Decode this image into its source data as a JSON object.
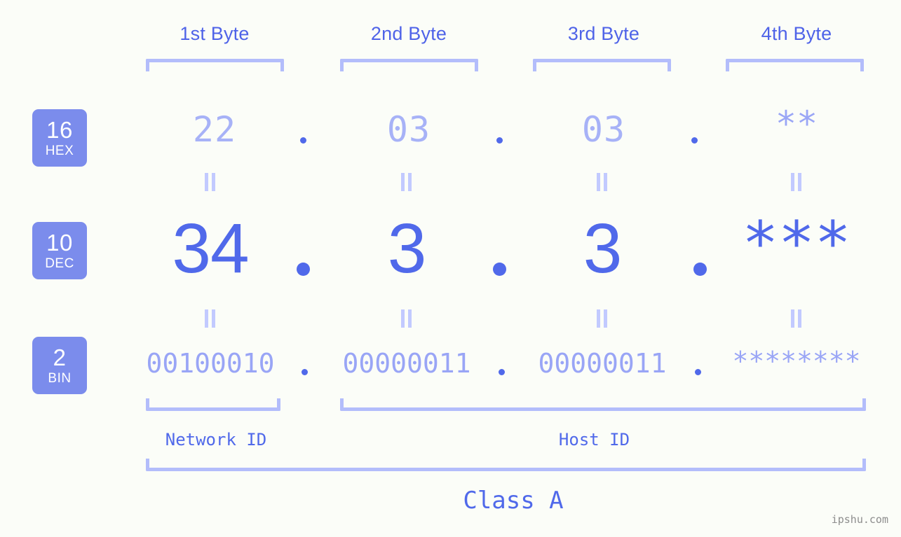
{
  "bytes": [
    {
      "label": "1st Byte"
    },
    {
      "label": "2nd Byte"
    },
    {
      "label": "3rd Byte"
    },
    {
      "label": "4th Byte"
    }
  ],
  "bases": [
    {
      "num": "16",
      "name": "HEX"
    },
    {
      "num": "10",
      "name": "DEC"
    },
    {
      "num": "2",
      "name": "BIN"
    }
  ],
  "rows": {
    "hex": {
      "values": [
        "22",
        "03",
        "03",
        "**"
      ],
      "separator": "."
    },
    "dec": {
      "values": [
        "34",
        "3",
        "3",
        "***"
      ],
      "separator": "."
    },
    "bin": {
      "values": [
        "00100010",
        "00000011",
        "00000011",
        "********"
      ],
      "separator": "."
    }
  },
  "equals_symbol": "=",
  "sections": {
    "network_id": "Network ID",
    "host_id": "Host ID",
    "class": "Class A"
  },
  "watermark": "ipshu.com",
  "colors": {
    "background": "#fbfdf8",
    "accent": "#5069ea",
    "badge": "#7b8cec",
    "light_accent": "#a7b2f7",
    "bracket": "#b3bdfb",
    "watermark": "#8d8d8d"
  }
}
